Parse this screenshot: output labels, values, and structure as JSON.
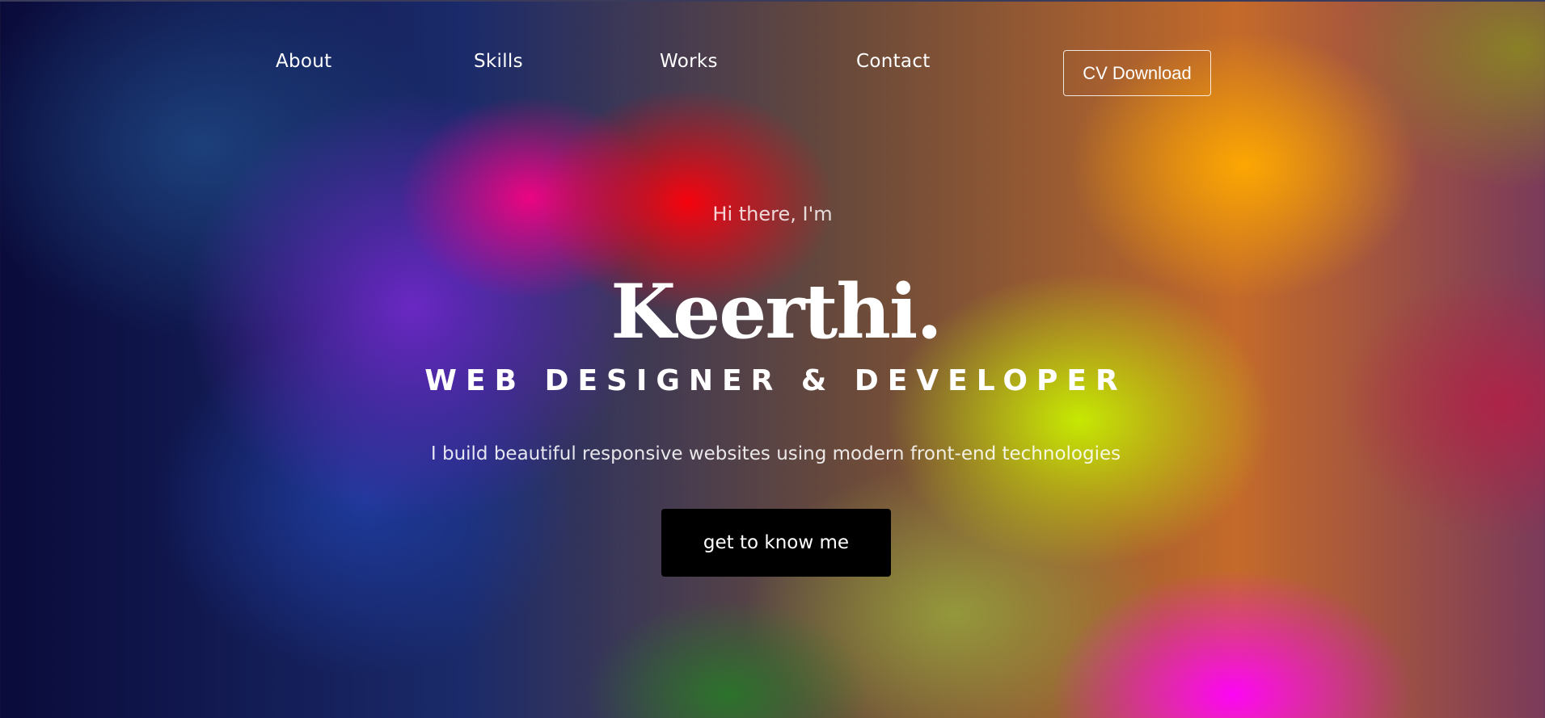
{
  "nav": {
    "items": [
      {
        "label": "About"
      },
      {
        "label": "Skills"
      },
      {
        "label": "Works"
      },
      {
        "label": "Contact"
      }
    ],
    "cv_button_label": "CV Download"
  },
  "hero": {
    "greeting": "Hi there, I'm",
    "name": "Keerthi.",
    "role": "WEB DESIGNER & DEVELOPER",
    "tagline": "I build beautiful responsive websites using modern front-end technologies",
    "cta_label": "get to know me"
  },
  "colors": {
    "text": "#ffffff",
    "cta_background": "#000000",
    "page_background": "#0a0b3a"
  }
}
